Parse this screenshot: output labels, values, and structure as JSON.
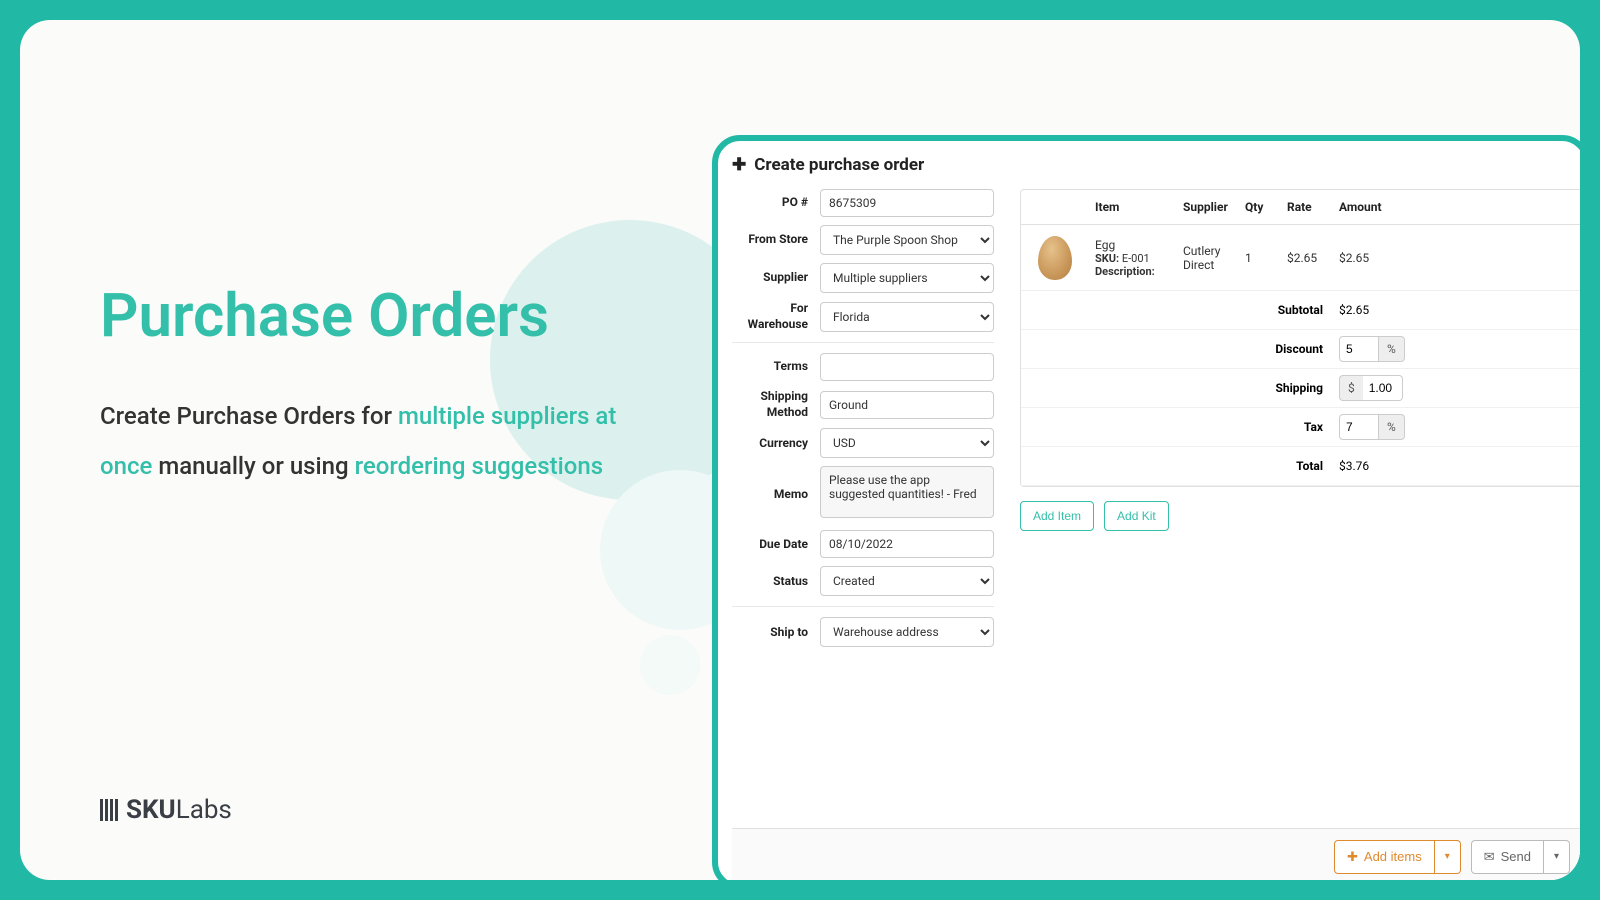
{
  "marketing": {
    "title": "Purchase Orders",
    "blurb_pre": "Create Purchase Orders for ",
    "blurb_hl1": "multiple suppliers at once",
    "blurb_mid": " manually or using ",
    "blurb_hl2": "reordering suggestions"
  },
  "logo": {
    "brandA": "SKU",
    "brandB": "Labs"
  },
  "window": {
    "title": "Create purchase order"
  },
  "form": {
    "labels": {
      "po": "PO #",
      "store": "From Store",
      "supplier": "Supplier",
      "warehouse": "For Warehouse",
      "terms": "Terms",
      "ship_method": "Shipping Method",
      "currency": "Currency",
      "memo": "Memo",
      "due": "Due Date",
      "status": "Status",
      "ship_to": "Ship to"
    },
    "values": {
      "po": "8675309",
      "store": "The Purple Spoon Shop",
      "supplier": "Multiple suppliers",
      "warehouse": "Florida",
      "terms": "",
      "ship_method": "Ground",
      "currency": "USD",
      "memo": "Please use the app suggested quantities! - Fred",
      "due": "08/10/2022",
      "status": "Created",
      "ship_to": "Warehouse address"
    }
  },
  "table": {
    "headers": {
      "item": "Item",
      "supplier": "Supplier",
      "qty": "Qty",
      "rate": "Rate",
      "amount": "Amount"
    },
    "rows": [
      {
        "name": "Egg",
        "sku_label": "SKU:",
        "sku": "E-001",
        "desc_label": "Description:",
        "supplier": "Cutlery Direct",
        "qty": "1",
        "rate": "$2.65",
        "amount": "$2.65"
      }
    ],
    "summary": {
      "subtotal_label": "Subtotal",
      "subtotal": "$2.65",
      "discount_label": "Discount",
      "discount_value": "5",
      "discount_unit": "%",
      "shipping_label": "Shipping",
      "shipping_unit": "$",
      "shipping_value": "1.00",
      "tax_label": "Tax",
      "tax_value": "7",
      "tax_unit": "%",
      "total_label": "Total",
      "total": "$3.76"
    },
    "buttons": {
      "add_item": "Add Item",
      "add_kit": "Add Kit"
    }
  },
  "bottombar": {
    "add_items": "Add items",
    "send": "Send"
  }
}
